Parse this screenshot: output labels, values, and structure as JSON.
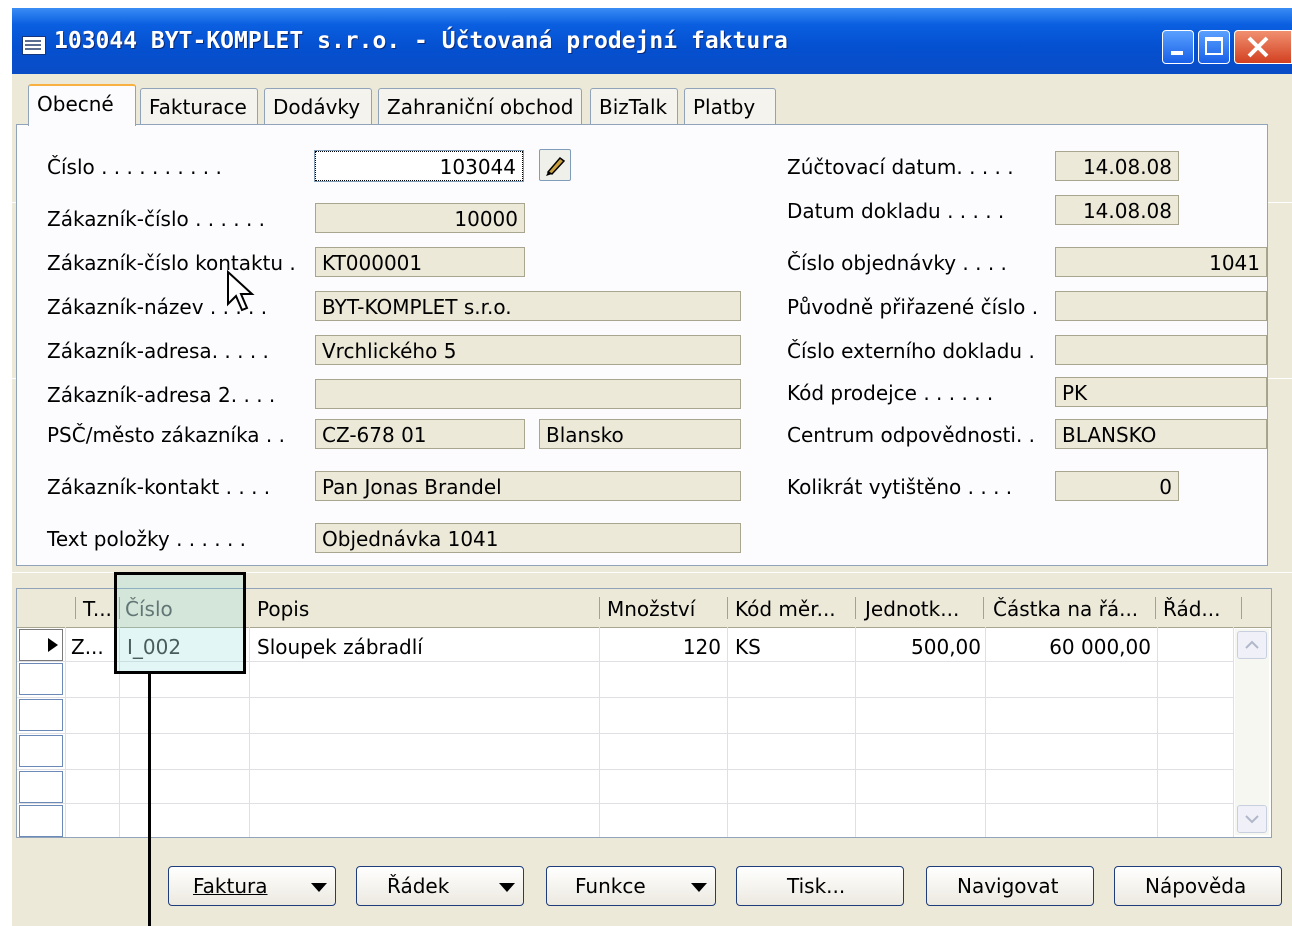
{
  "window": {
    "title": "103044 BYT-KOMPLET s.r.o. - Účtovaná prodejní faktura",
    "icon": "list-window-icon"
  },
  "tabs": [
    "Obecné",
    "Fakturace",
    "Dodávky",
    "Zahraniční obchod",
    "BizTalk",
    "Platby"
  ],
  "general": {
    "cislo_label": "Číslo . . . . . . . . . .",
    "cislo_value": "103044",
    "zakaznik_cislo_label": "Zákazník-číslo . . . . . .",
    "zakaznik_cislo_value": "10000",
    "kontakt_cislo_label": "Zákazník-číslo kontaktu  .",
    "kontakt_cislo_value": "KT000001",
    "nazev_label": "Zákazník-název . . . . .",
    "nazev_value": "BYT-KOMPLET s.r.o.",
    "adresa_label": "Zákazník-adresa. . . . .",
    "adresa_value": "Vrchlického 5",
    "adresa2_label": "Zákazník-adresa 2. . . .",
    "adresa2_value": "",
    "psc_label": "PSČ/město zákazníka . .",
    "psc_value": "CZ-678 01",
    "mesto_value": "Blansko",
    "kontakt_label": "Zákazník-kontakt . . . .",
    "kontakt_value": "Pan Jonas Brandel",
    "text_label": "Text položky . . . . . .",
    "text_value": "Objednávka 1041",
    "zuct_datum_label": "Zúčtovací datum. . . . .",
    "zuct_datum_value": "14.08.08",
    "datum_dokladu_label": "Datum dokladu . . . . .",
    "datum_dokladu_value": "14.08.08",
    "cislo_obj_label": "Číslo objednávky . . . .",
    "cislo_obj_value": "1041",
    "puvodni_label": "Původně přiřazené číslo .",
    "puvodni_value": "",
    "externi_label": "Číslo externího dokladu .",
    "externi_value": "",
    "prodejce_label": "Kód prodejce . . . . . .",
    "prodejce_value": "PK",
    "centrum_label": "Centrum odpovědnosti. .",
    "centrum_value": "BLANSKO",
    "vytisteno_label": "Kolikrát vytištěno . . . .",
    "vytisteno_value": "0"
  },
  "lines": {
    "headers": [
      "T...",
      "Číslo",
      "Popis",
      "Množství",
      "Kód měr...",
      "Jednotk...",
      "Částka na řá...",
      "Řád..."
    ],
    "rows": [
      {
        "typ": "Z...",
        "cislo": "I_002",
        "popis": "Sloupek zábradlí",
        "mnozstvi": "120",
        "kod": "KS",
        "jednotkova": "500,00",
        "castka": "60 000,00",
        "radek": ""
      }
    ]
  },
  "buttons": {
    "faktura": "Faktura",
    "radek": "Řádek",
    "funkce": "Funkce",
    "tisk": "Tisk...",
    "navigovat": "Navigovat",
    "napoveda": "Nápověda"
  }
}
